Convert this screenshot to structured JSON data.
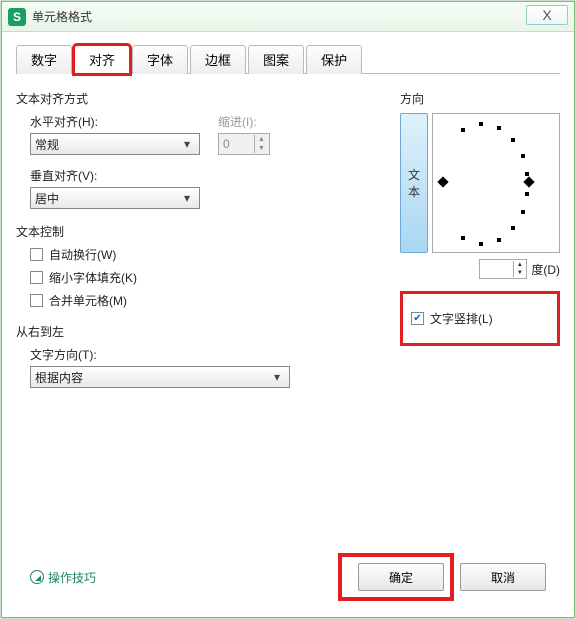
{
  "window": {
    "app_icon_letter": "S",
    "title": "单元格格式",
    "close_glyph": "X"
  },
  "tabs": [
    "数字",
    "对齐",
    "字体",
    "边框",
    "图案",
    "保护"
  ],
  "active_tab_index": 1,
  "align": {
    "section_title": "文本对齐方式",
    "h_label": "水平对齐(H):",
    "h_value": "常规",
    "indent_label": "缩进(I):",
    "indent_value": "0",
    "v_label": "垂直对齐(V):",
    "v_value": "居中"
  },
  "text_control": {
    "section_title": "文本控制",
    "wrap": "自动换行(W)",
    "shrink": "缩小字体填充(K)",
    "merge": "合并单元格(M)"
  },
  "rtl": {
    "section_title": "从右到左",
    "dir_label": "文字方向(T):",
    "dir_value": "根据内容"
  },
  "orientation": {
    "section_title": "方向",
    "vert_btn_line1": "文",
    "vert_btn_line2": "本",
    "degree_label": "度(D)",
    "vertical_text_label": "文字竖排(L)",
    "vertical_text_checked": true
  },
  "footer": {
    "tips": "操作技巧",
    "ok": "确定",
    "cancel": "取消"
  }
}
